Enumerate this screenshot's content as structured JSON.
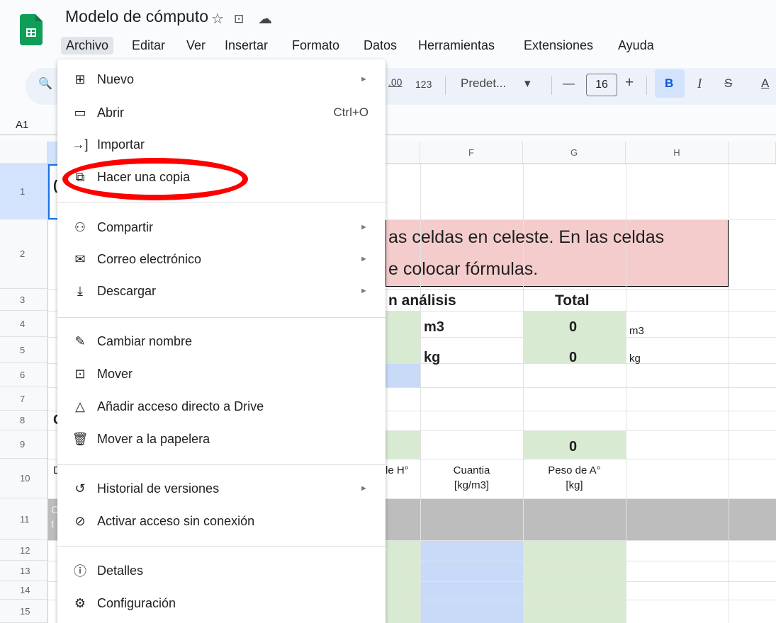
{
  "header": {
    "doc_title": "Modelo de cómputo",
    "star": "☆",
    "folder": "⊡",
    "cloud": "☁"
  },
  "menubar": [
    "Archivo",
    "Editar",
    "Ver",
    "Insertar",
    "Formato",
    "Datos",
    "Herramientas",
    "Extensiones",
    "Ayuda"
  ],
  "toolbar": {
    "search": "🔍",
    "decimal": ".00",
    "numfmt": "123",
    "font": "Predet...",
    "dropdown": "▾",
    "minus": "—",
    "font_size": "16",
    "plus": "+",
    "bold": "B",
    "italic": "I",
    "strike": "S",
    "textcolor": "A"
  },
  "namebox": "A1",
  "columns": [
    "F",
    "G",
    "H"
  ],
  "rows": [
    "1",
    "2",
    "3",
    "4",
    "5",
    "6",
    "7",
    "8",
    "9",
    "10",
    "11",
    "12",
    "13",
    "14",
    "15"
  ],
  "cells": {
    "banner_line1": "as celdas en celeste. En las celdas",
    "banner_line2": "e colocar fórmulas.",
    "r3_analisis": "n análisis",
    "r3_total": "Total",
    "r4_unit": "m3",
    "r4_val": "0",
    "r4_unit2": "m3",
    "r5_unit": "kg",
    "r5_val": "0",
    "r5_unit2": "kg",
    "r8_c": "C",
    "r9_val": "0",
    "r10_d": "D",
    "r10_e": "le H°",
    "r10_f_l1": "Cuantia",
    "r10_f_l2": "[kg/m3]",
    "r10_g_l1": "Peso de A°",
    "r10_g_l2": "[kg]",
    "r11_c": "C",
    "r11_t": "t"
  },
  "file_menu": {
    "items": [
      {
        "icon": "new-icon",
        "glyph": "⊞",
        "label": "Nuevo",
        "arrow": "►",
        "shortcut": ""
      },
      {
        "icon": "folder-open-icon",
        "glyph": "▭",
        "label": "Abrir",
        "arrow": "",
        "shortcut": "Ctrl+O"
      },
      {
        "icon": "import-icon",
        "glyph": "→]",
        "label": "Importar",
        "arrow": "",
        "shortcut": ""
      },
      {
        "icon": "copy-icon",
        "glyph": "⧉",
        "label": "Hacer una copia",
        "arrow": "",
        "shortcut": ""
      },
      {
        "icon": "share-icon",
        "glyph": "⚇",
        "label": "Compartir",
        "arrow": "►",
        "shortcut": ""
      },
      {
        "icon": "email-icon",
        "glyph": "✉",
        "label": "Correo electrónico",
        "arrow": "►",
        "shortcut": ""
      },
      {
        "icon": "download-icon",
        "glyph": "⤓",
        "label": "Descargar",
        "arrow": "►",
        "shortcut": ""
      },
      {
        "icon": "rename-icon",
        "glyph": "✎",
        "label": "Cambiar nombre",
        "arrow": "",
        "shortcut": ""
      },
      {
        "icon": "move-icon",
        "glyph": "⊡",
        "label": "Mover",
        "arrow": "",
        "shortcut": ""
      },
      {
        "icon": "drive-shortcut-icon",
        "glyph": "△",
        "label": "Añadir acceso directo a Drive",
        "arrow": "",
        "shortcut": ""
      },
      {
        "icon": "trash-icon",
        "glyph": "🗑",
        "label": "Mover a la papelera",
        "arrow": "",
        "shortcut": ""
      },
      {
        "icon": "history-icon",
        "glyph": "↺",
        "label": "Historial de versiones",
        "arrow": "►",
        "shortcut": ""
      },
      {
        "icon": "offline-icon",
        "glyph": "⊘",
        "label": "Activar acceso sin conexión",
        "arrow": "",
        "shortcut": ""
      },
      {
        "icon": "info-icon",
        "glyph": "ⓘ",
        "label": "Detalles",
        "arrow": "",
        "shortcut": ""
      },
      {
        "icon": "gear-icon",
        "glyph": "⚙",
        "label": "Configuración",
        "arrow": "",
        "shortcut": ""
      }
    ]
  },
  "colors": {
    "highlight": "#ff0000",
    "green_cell": "#d9ead3",
    "blue_cell": "#c9daf8",
    "pink_banner": "#f4cccc",
    "gray_row": "#bdbdbd"
  }
}
